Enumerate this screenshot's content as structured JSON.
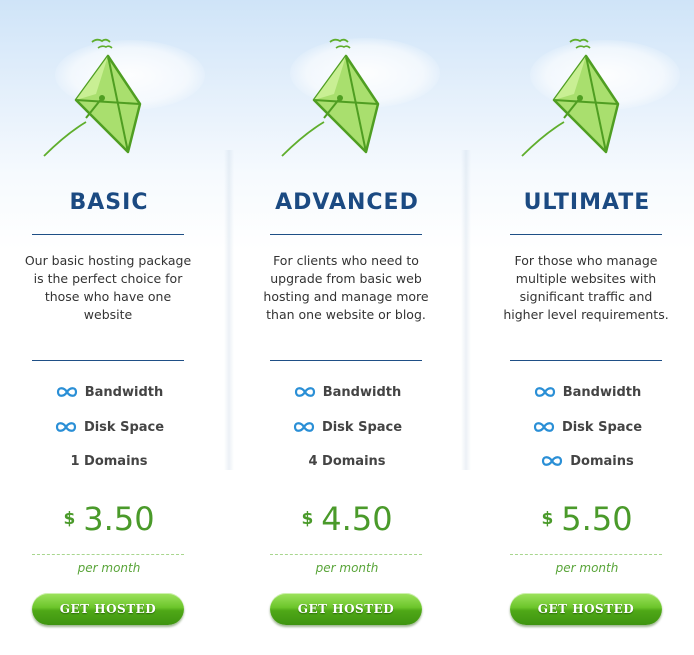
{
  "colors": {
    "title": "#1b4a82",
    "price": "#4a9a2a",
    "button": "#5bb51e",
    "rule": "#1f4f86"
  },
  "plans": [
    {
      "title": "BASIC",
      "description": "Our basic hosting package is the perfect choice for those who have one website",
      "features": [
        {
          "label": "Bandwidth",
          "icon": "infinity-icon"
        },
        {
          "label": "Disk Space",
          "icon": "infinity-icon"
        },
        {
          "label": "1 Domains",
          "icon": ""
        }
      ],
      "currency": "$",
      "price": "3.50",
      "period": "per month",
      "button": "GET HOSTED"
    },
    {
      "title": "ADVANCED",
      "description": "For clients who need to upgrade from basic web hosting and manage more than one website or blog.",
      "features": [
        {
          "label": "Bandwidth",
          "icon": "infinity-icon"
        },
        {
          "label": "Disk Space",
          "icon": "infinity-icon"
        },
        {
          "label": "4 Domains",
          "icon": ""
        }
      ],
      "currency": "$",
      "price": "4.50",
      "period": "per month",
      "button": "GET HOSTED"
    },
    {
      "title": "ULTIMATE",
      "description": "For those who manage multiple websites with significant traffic and higher level requirements.",
      "features": [
        {
          "label": "Bandwidth",
          "icon": "infinity-icon"
        },
        {
          "label": "Disk Space",
          "icon": "infinity-icon"
        },
        {
          "label": "Domains",
          "icon": "infinity-icon"
        }
      ],
      "currency": "$",
      "price": "5.50",
      "period": "per month",
      "button": "GET HOSTED"
    }
  ]
}
